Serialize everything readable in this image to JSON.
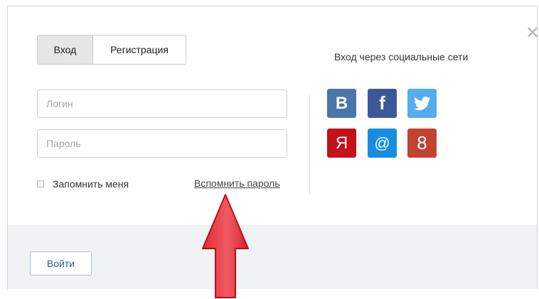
{
  "tabs": {
    "login": "Вход",
    "register": "Регистрация"
  },
  "form": {
    "login_placeholder": "Логин",
    "password_placeholder": "Пароль",
    "remember_label": "Запомнить меня",
    "forgot_label": "Вспомнить пароль"
  },
  "social": {
    "title": "Вход через социальные сети",
    "buttons": [
      {
        "name": "vk",
        "glyph": "B",
        "color": "#4a76a8"
      },
      {
        "name": "facebook",
        "glyph": "f",
        "color": "#3b5998"
      },
      {
        "name": "twitter",
        "glyph": "",
        "color": "#55acee"
      },
      {
        "name": "yandex",
        "glyph": "Я",
        "color": "#c4111a"
      },
      {
        "name": "mailru",
        "glyph": "@",
        "color": "#168de2"
      },
      {
        "name": "odnoklassniki",
        "glyph": "8",
        "color": "#c2432f"
      }
    ]
  },
  "footer": {
    "submit_label": "Войти"
  },
  "colors": {
    "arrow": "#e8323b",
    "accent": "#2a5d8f"
  }
}
